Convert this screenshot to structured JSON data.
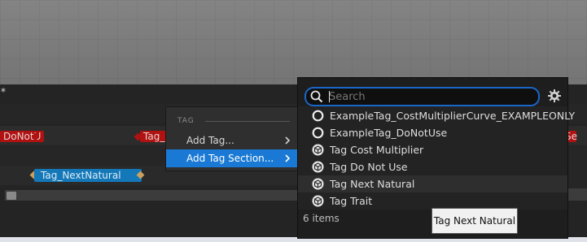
{
  "timeline": {
    "asterisk": "*",
    "red_tags": [
      "DoNotU",
      "Tag_",
      "Se"
    ],
    "blue_tag": "Tag_NextNatural",
    "colors": {
      "red_tag": "#b01212",
      "blue_tag": "#1478b8",
      "diamond": "#c8a060"
    }
  },
  "context_menu": {
    "heading": "TAG",
    "items": [
      {
        "label": "Add Tag...",
        "arrow": "chevron-right-icon"
      },
      {
        "label": "Add Tag Section...",
        "arrow": "chevron-right-icon",
        "highlighted": true
      }
    ]
  },
  "picker": {
    "search": {
      "placeholder": "Search",
      "value": ""
    },
    "items": [
      {
        "label": "ExampleTag_CostMultiplierCurve_EXAMPLEONLY",
        "icon": "ring-icon"
      },
      {
        "label": "ExampleTag_DoNotUse",
        "icon": "ring-icon"
      },
      {
        "label": "Tag Cost Multiplier",
        "icon": "cube-icon"
      },
      {
        "label": "Tag Do Not Use",
        "icon": "cube-icon"
      },
      {
        "label": "Tag Next Natural",
        "icon": "cube-icon",
        "hovered": true
      },
      {
        "label": "Tag Trait",
        "icon": "cube-icon"
      }
    ],
    "count": "6 items",
    "tooltip": "Tag Next Natural",
    "accent": "#1a67c8"
  }
}
